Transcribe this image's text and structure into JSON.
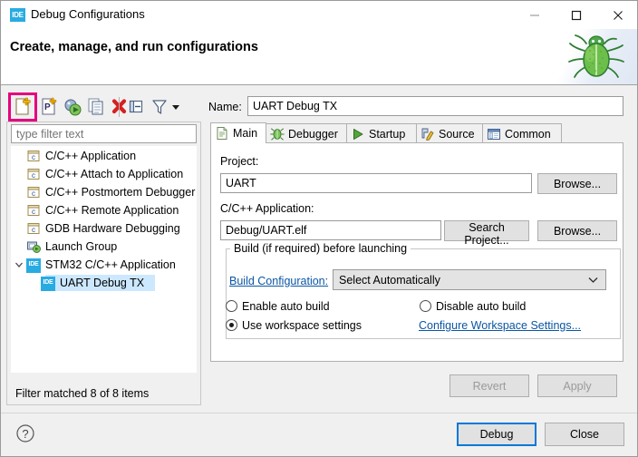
{
  "window": {
    "title": "Debug Configurations",
    "icon": "ide-badge-icon",
    "controls": {
      "minimize": "minimize-icon",
      "maximize": "maximize-icon",
      "close": "close-icon"
    }
  },
  "header": {
    "title": "Create, manage, and run configurations",
    "decoration_icon": "green-bug-icon"
  },
  "toolbar": {
    "items": [
      {
        "name": "new-launch-configuration",
        "icon": "new-file-icon",
        "highlighted": true
      },
      {
        "name": "new-prototype",
        "icon": "new-prototype-icon",
        "highlighted": false
      },
      {
        "name": "export-configuration",
        "icon": "export-run-icon",
        "highlighted": false
      },
      {
        "name": "duplicate-configuration",
        "icon": "duplicate-icon",
        "highlighted": false
      },
      {
        "name": "delete-configuration",
        "icon": "delete-red-x-icon",
        "highlighted": false
      },
      {
        "name": "collapse-all",
        "icon": "collapse-all-icon",
        "highlighted": false
      },
      {
        "name": "filter-configurations",
        "icon": "filter-funnel-icon",
        "highlighted": false
      },
      {
        "name": "view-menu",
        "icon": "chevron-down-icon",
        "highlighted": false
      }
    ],
    "highlight_color": "#e6007e"
  },
  "filter": {
    "placeholder": "type filter text",
    "value": "",
    "status": "Filter matched 8 of 8 items"
  },
  "tree": {
    "selection_color": "#cce8ff",
    "items": [
      {
        "label": "C/C++ Application",
        "icon": "c-app-icon",
        "indent": 1,
        "twisty": "",
        "selected": false
      },
      {
        "label": "C/C++ Attach to Application",
        "icon": "c-app-icon",
        "indent": 1,
        "twisty": "",
        "selected": false
      },
      {
        "label": "C/C++ Postmortem Debugger",
        "icon": "c-app-icon",
        "indent": 1,
        "twisty": "",
        "selected": false
      },
      {
        "label": "C/C++ Remote Application",
        "icon": "c-app-icon",
        "indent": 1,
        "twisty": "",
        "selected": false
      },
      {
        "label": "GDB Hardware Debugging",
        "icon": "c-app-icon",
        "indent": 1,
        "twisty": "",
        "selected": false
      },
      {
        "label": "Launch Group",
        "icon": "launch-group-icon",
        "indent": 1,
        "twisty": "",
        "selected": false
      },
      {
        "label": "STM32 C/C++ Application",
        "icon": "ide-badge-icon",
        "indent": 1,
        "twisty": "expanded",
        "selected": false
      },
      {
        "label": "UART Debug TX",
        "icon": "ide-badge-icon",
        "indent": 2,
        "twisty": "",
        "selected": true
      }
    ]
  },
  "config": {
    "name_label": "Name:",
    "name_value": "UART Debug TX",
    "tabs": [
      {
        "label": "Main",
        "icon": "document-icon",
        "active": true
      },
      {
        "label": "Debugger",
        "icon": "debugger-bug-icon",
        "active": false
      },
      {
        "label": "Startup",
        "icon": "green-play-icon",
        "active": false
      },
      {
        "label": "Source",
        "icon": "source-pencil-icon",
        "active": false
      },
      {
        "label": "Common",
        "icon": "common-window-icon",
        "active": false
      }
    ],
    "main_tab": {
      "project_label": "Project:",
      "project_value": "UART",
      "project_browse": "Browse...",
      "application_label": "C/C++ Application:",
      "application_value": "Debug/UART.elf",
      "application_search": "Search Project...",
      "application_browse": "Browse...",
      "build_group_title": "Build (if required) before launching",
      "build_config_link": "Build Configuration:",
      "build_config_value": "Select Automatically",
      "build_config_options": [
        "Select Automatically"
      ],
      "radio_enable_auto_build": "Enable auto build",
      "radio_disable_auto_build": "Disable auto build",
      "radio_use_workspace_settings": "Use workspace settings",
      "configure_workspace_link": "Configure Workspace Settings...",
      "selected_radio": "use_workspace_settings"
    },
    "revert_button": "Revert",
    "apply_button": "Apply",
    "revert_enabled": false,
    "apply_enabled": false
  },
  "footer": {
    "help_icon": "help-question-icon",
    "debug_button": "Debug",
    "close_button": "Close",
    "default_button_color": "#0078d7"
  }
}
